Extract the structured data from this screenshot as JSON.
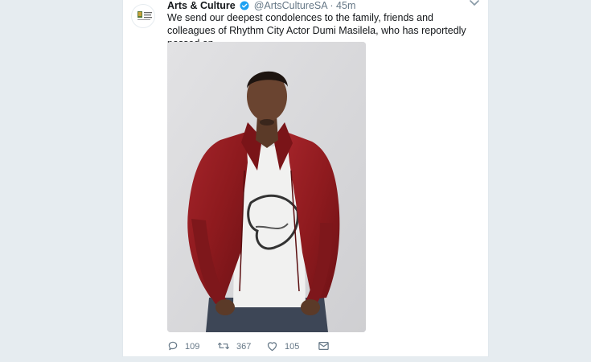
{
  "tweet": {
    "account_name": "Arts & Culture",
    "handle": "@ArtsCultureSA",
    "separator": "·",
    "time": "45m",
    "text": "We send our deepest condolences to the family, friends and colleagues of Rhythm City Actor Dumi Masilela, who has reportedly passed on.",
    "verified": true
  },
  "actions": {
    "reply_count": "109",
    "retweet_count": "367",
    "like_count": "105"
  },
  "icons": {
    "reply": "reply-icon",
    "retweet": "retweet-icon",
    "like": "heart-icon",
    "message": "envelope-icon",
    "more": "chevron-down-icon"
  },
  "colors": {
    "background": "#e6ecf0",
    "card": "#ffffff",
    "verified": "#1da1f2",
    "muted": "#657786",
    "jacket": "#8e1a1e"
  }
}
